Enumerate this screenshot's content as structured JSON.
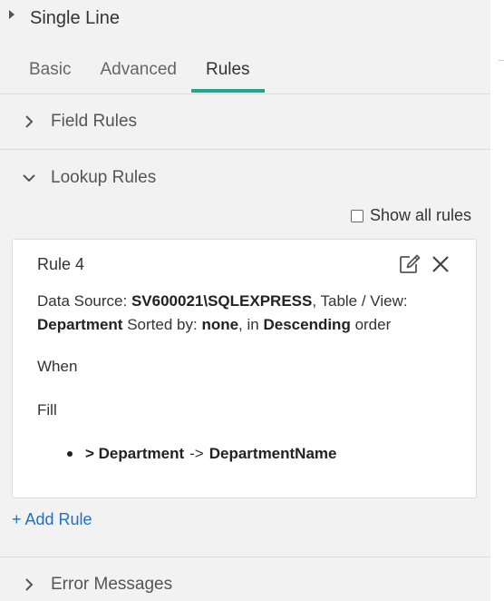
{
  "header": {
    "title": "Single Line"
  },
  "tabs": [
    {
      "label": "Basic",
      "active": false
    },
    {
      "label": "Advanced",
      "active": false
    },
    {
      "label": "Rules",
      "active": true
    }
  ],
  "sections": {
    "field_rules": {
      "label": "Field Rules",
      "expanded": false
    },
    "lookup_rules": {
      "label": "Lookup Rules",
      "expanded": true
    },
    "error_messages": {
      "label": "Error Messages",
      "expanded": false
    }
  },
  "show_all_rules": {
    "label": "Show all rules",
    "checked": false
  },
  "rule": {
    "title": "Rule 4",
    "data_source_prefix": "Data Source:",
    "data_source": "SV600021\\SQLEXPRESS",
    "table_view_prefix": ", Table / View:",
    "table_view": "Department",
    "sorted_by_prefix": "Sorted by:",
    "sorted_by": "none",
    "in_prefix": ", in",
    "order_direction": "Descending",
    "order_suffix": "order",
    "when_label": "When",
    "fill_label": "Fill",
    "fill_mappings": [
      {
        "source": "> Department",
        "arrow": "->",
        "target": "DepartmentName"
      }
    ]
  },
  "add_rule": {
    "label": "+ Add Rule"
  },
  "icons": {
    "edit": "edit-icon",
    "close": "close-icon",
    "chevron_right": "chevron-right-icon",
    "chevron_down": "chevron-down-icon",
    "caret_right": "caret-right-icon"
  },
  "colors": {
    "accent": "#1aaa8c",
    "link": "#1a73c8",
    "background": "#f2f2f2",
    "card": "#ffffff"
  }
}
